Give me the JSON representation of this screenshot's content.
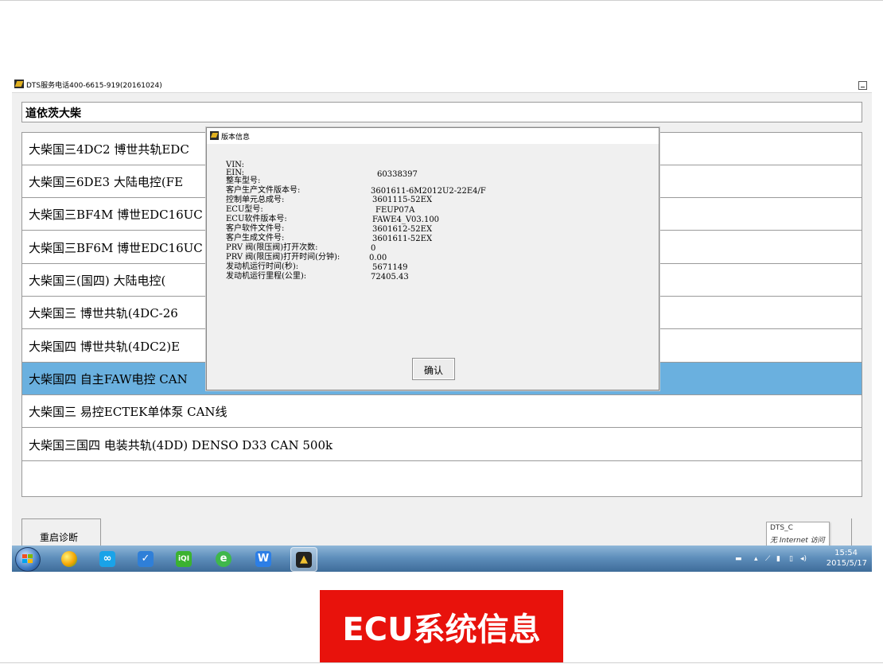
{
  "window": {
    "title": "DTS服务电话400-6615-919(20161024)"
  },
  "brand": {
    "text": "道依茨大柴"
  },
  "list": {
    "items": [
      {
        "label": "大柴国三4DC2 博世共轨EDC"
      },
      {
        "label": "大柴国三6DE3 大陆电控(FE"
      },
      {
        "label": "大柴国三BF4M 博世EDC16UC"
      },
      {
        "label": "大柴国三BF6M 博世EDC16UC"
      },
      {
        "label": "大柴国三(国四) 大陆电控("
      },
      {
        "label": "大柴国三 博世共轨(4DC-26"
      },
      {
        "label": "大柴国四 博世共轨(4DC2)E"
      },
      {
        "label": "大柴国四 自主FAW电控 CAN",
        "selected": true
      },
      {
        "label": "大柴国三 易控ECTEK单体泵 CAN线"
      },
      {
        "label": "大柴国三国四 电装共轨(4DD) DENSO D33 CAN 500k"
      }
    ]
  },
  "bottom": {
    "restart_label": "重启诊断"
  },
  "network": {
    "name": "DTS_C",
    "status": "无 Internet 访问"
  },
  "taskbar": {
    "apps": [
      "windows-start",
      "360-browser",
      "cloud-sync",
      "feedback",
      "iqiyi",
      "ie-browser",
      "wps",
      "dts-diagnostic"
    ],
    "time": "15:54",
    "date": "2015/5/17"
  },
  "dialog": {
    "title": "版本信息",
    "ok_label": "确认",
    "fields": [
      {
        "label": "VIN:",
        "value": ""
      },
      {
        "label": "EIN:",
        "value": "60338397"
      },
      {
        "label": "整车型号:",
        "value": ""
      },
      {
        "label": "客户生产文件版本号:",
        "value": "3601611-6M2012U2-22E4/F"
      },
      {
        "label": "控制单元总成号:",
        "value": "3601115-52EX"
      },
      {
        "label": "ECU型号:",
        "value": "FEUP07A"
      },
      {
        "label": "ECU软件版本号:",
        "value": "FAWE4_V03.100"
      },
      {
        "label": "客户软件文件号:",
        "value": "3601612-52EX"
      },
      {
        "label": "客户生成文件号:",
        "value": "3601611-52EX"
      },
      {
        "label": "PRV 阀(限压阀)打开次数:",
        "value": "0"
      },
      {
        "label": "PRV 阀(限压阀)打开时间(分钟):",
        "value": "0.00"
      },
      {
        "label": "发动机运行时间(秒):",
        "value": "5671149"
      },
      {
        "label": "发动机运行里程(公里):",
        "value": "72405.43"
      }
    ]
  },
  "caption": {
    "text": "ECU系统信息"
  }
}
